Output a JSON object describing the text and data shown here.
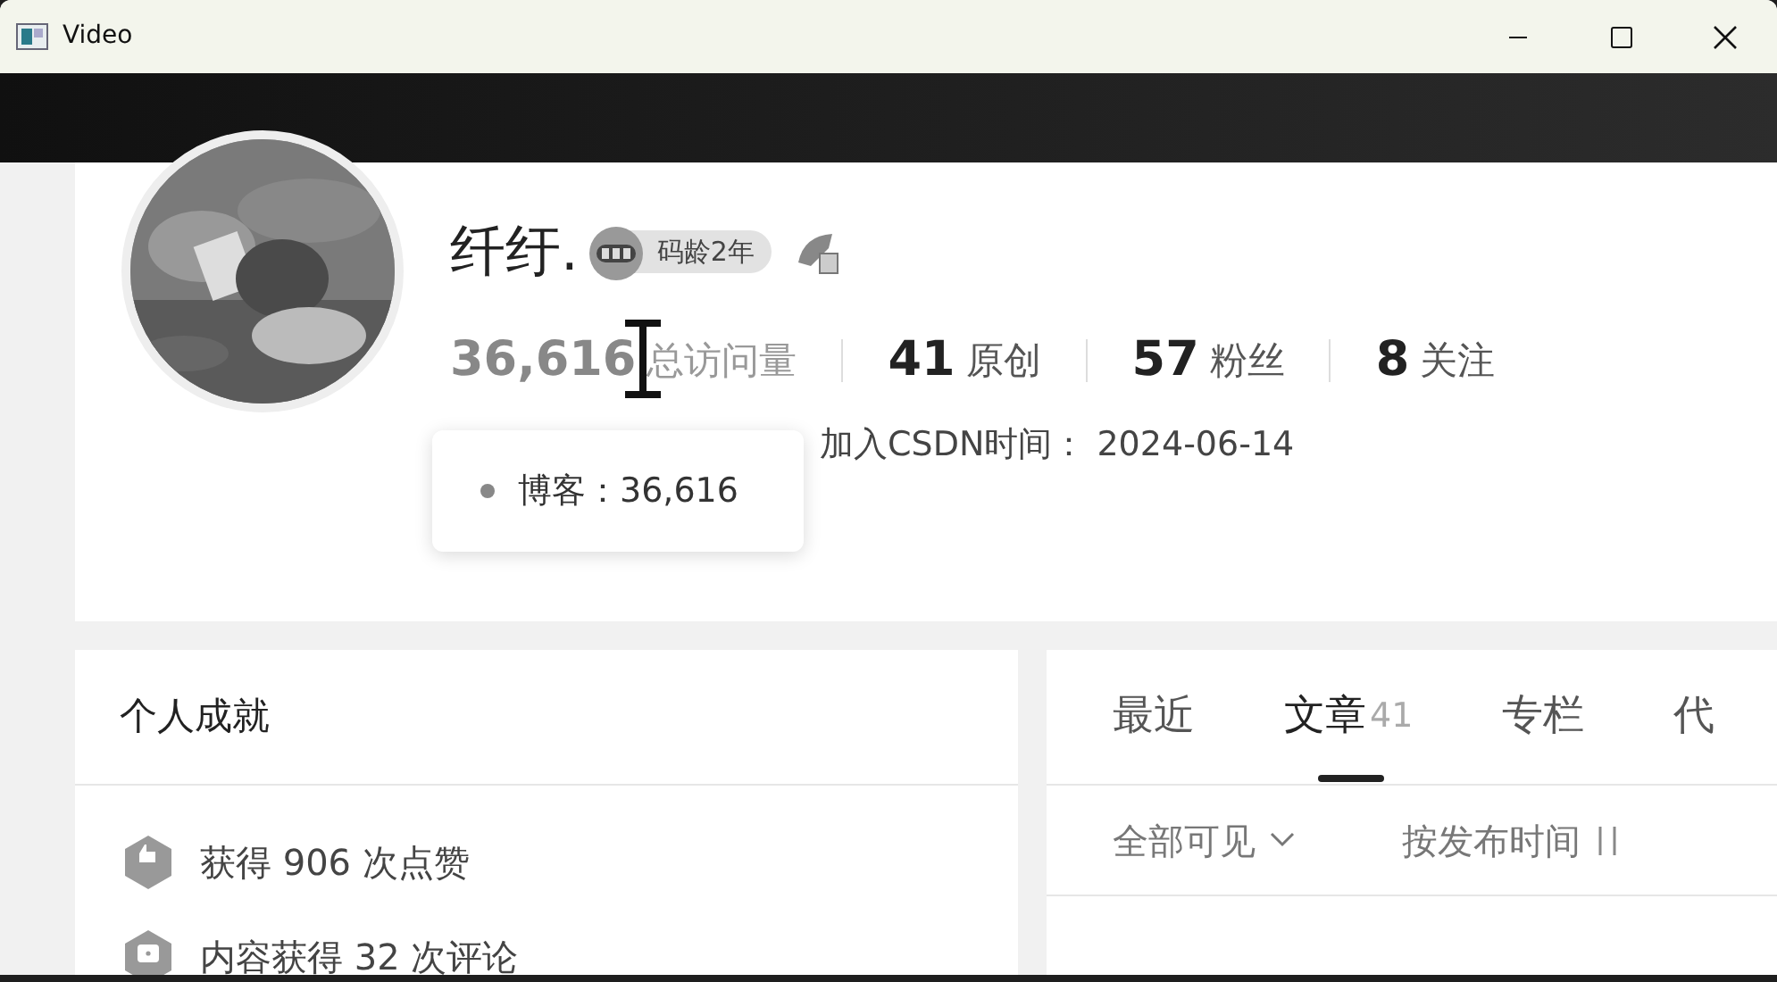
{
  "window": {
    "title": "Video"
  },
  "profile": {
    "name": "纤纡.",
    "badge": "码龄2年",
    "stats": [
      {
        "value": "36,616",
        "label": "总访问量",
        "hovered": true
      },
      {
        "value": "41",
        "label": "原创",
        "hovered": false
      },
      {
        "value": "57",
        "label": "粉丝",
        "hovered": false
      },
      {
        "value": "8",
        "label": "关注",
        "hovered": false
      }
    ],
    "join_date": "加入CSDN时间： 2024-06-14",
    "tooltip": "博客：36,616"
  },
  "achievements": {
    "title": "个人成就",
    "items": [
      {
        "kind": "like",
        "text": "获得 906 次点赞"
      },
      {
        "kind": "comment",
        "text": "内容获得 32 次评论"
      }
    ]
  },
  "tabs": [
    {
      "label": "最近",
      "selected": false
    },
    {
      "label": "文章",
      "count": "41",
      "selected": true
    },
    {
      "label": "专栏",
      "selected": false
    },
    {
      "label": "代",
      "selected": false
    }
  ],
  "filters": {
    "visibility": "全部可见",
    "sort": "按发布时间"
  }
}
